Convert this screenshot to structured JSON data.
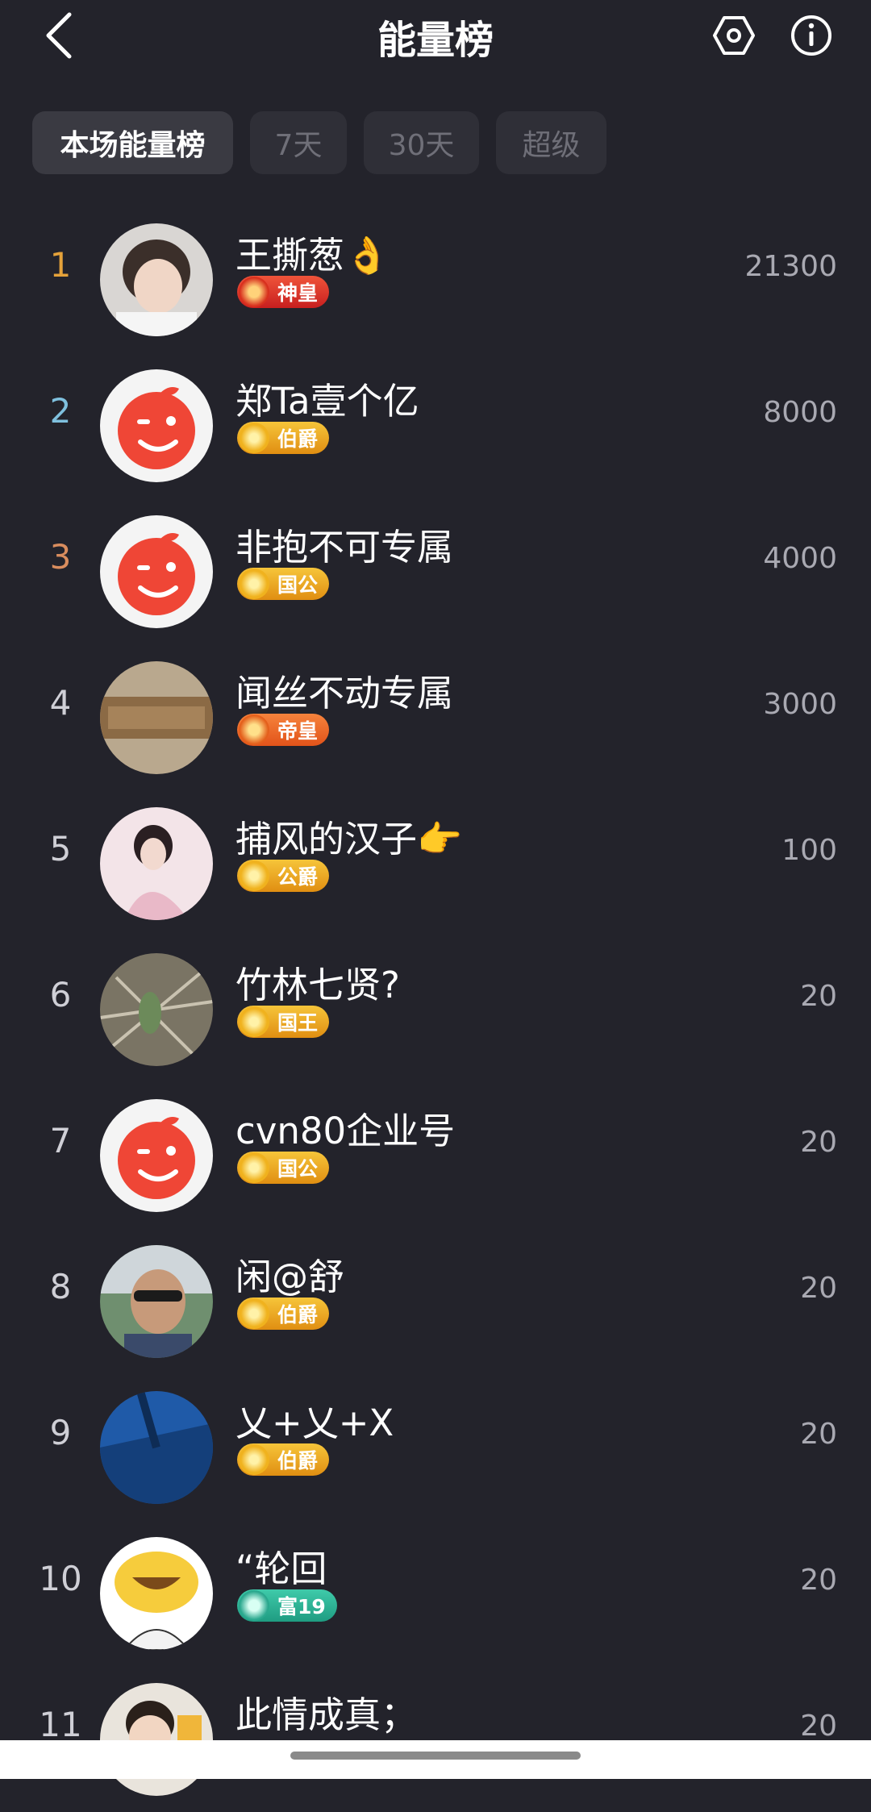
{
  "header": {
    "title": "能量榜"
  },
  "tabs": [
    {
      "label": "本场能量榜",
      "active": true
    },
    {
      "label": "7天",
      "active": false
    },
    {
      "label": "30天",
      "active": false
    },
    {
      "label": "超级",
      "active": false
    }
  ],
  "colors": {
    "rank1": "#e5a23a",
    "rank2": "#7fc0de",
    "rank3": "#d98d5e",
    "rank_other": "#cfcfd6",
    "gold_badge": "#e9a81c",
    "red_badge": "#e23a2e",
    "orange_badge": "#f06a22",
    "teal_badge": "#2fb59a"
  },
  "ranking": [
    {
      "rank": "1",
      "name": "王撕葱👌",
      "badge": "神皇",
      "badge_type": "red",
      "score": "21300",
      "avatar": "photo-woman"
    },
    {
      "rank": "2",
      "name": "郑Ta壹个亿",
      "badge": "伯爵",
      "badge_type": "gold",
      "score": "8000",
      "avatar": "default-wink"
    },
    {
      "rank": "3",
      "name": "非抱不可专属",
      "badge": "国公",
      "badge_type": "gold",
      "score": "4000",
      "avatar": "default-wink"
    },
    {
      "rank": "4",
      "name": "闻丝不动专属",
      "badge": "帝皇",
      "badge_type": "orange",
      "score": "3000",
      "avatar": "photo-wood"
    },
    {
      "rank": "5",
      "name": "捕风的汉子👉",
      "badge": "公爵",
      "badge_type": "gold",
      "score": "100",
      "avatar": "photo-costume"
    },
    {
      "rank": "6",
      "name": "竹林七贤?",
      "badge": "国王",
      "badge_type": "gold",
      "score": "20",
      "avatar": "photo-bamboo"
    },
    {
      "rank": "7",
      "name": "cvn80企业号",
      "badge": "国公",
      "badge_type": "gold",
      "score": "20",
      "avatar": "default-wink"
    },
    {
      "rank": "8",
      "name": "闲@舒",
      "badge": "伯爵",
      "badge_type": "gold",
      "score": "20",
      "avatar": "photo-man"
    },
    {
      "rank": "9",
      "name": "乂+乂+X",
      "badge": "伯爵",
      "badge_type": "gold",
      "score": "20",
      "avatar": "photo-blue"
    },
    {
      "rank": "10",
      "name": "“轮回",
      "badge": "富19",
      "badge_type": "teal",
      "score": "20",
      "avatar": "cartoon-smile"
    },
    {
      "rank": "11",
      "name": "此情成真；",
      "badge": "",
      "badge_type": "none",
      "score": "20",
      "avatar": "photo-child"
    }
  ]
}
